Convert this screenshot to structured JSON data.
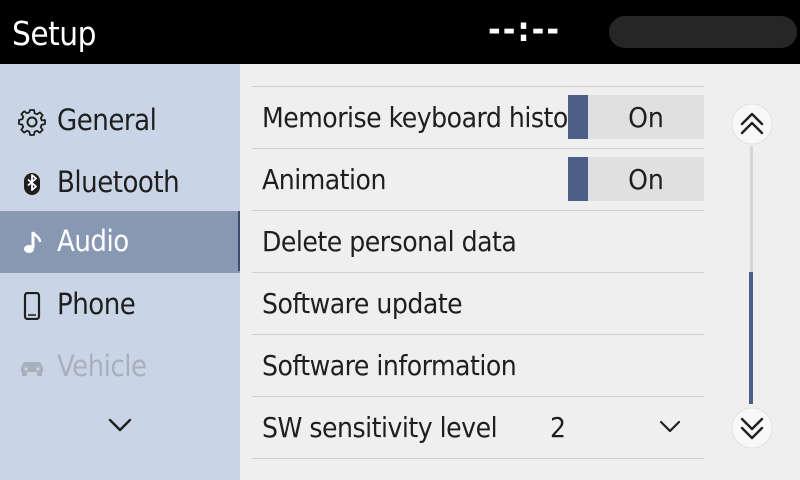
{
  "header": {
    "title": "Setup",
    "clock": "--:--"
  },
  "sidebar": {
    "items": [
      {
        "label": "General",
        "icon": "gear-icon",
        "state": "normal"
      },
      {
        "label": "Bluetooth",
        "icon": "bluetooth-icon",
        "state": "normal"
      },
      {
        "label": "Audio",
        "icon": "music-note-icon",
        "state": "selected"
      },
      {
        "label": "Phone",
        "icon": "phone-icon",
        "state": "normal"
      },
      {
        "label": "Vehicle",
        "icon": "car-icon",
        "state": "disabled"
      }
    ],
    "more_icon": "chevron-down-icon"
  },
  "settings": {
    "rows": [
      {
        "label": "Memorise keyboard history",
        "toggle": "On"
      },
      {
        "label": "Animation",
        "toggle": "On"
      },
      {
        "label": "Delete personal data"
      },
      {
        "label": "Software update"
      },
      {
        "label": "Software information"
      },
      {
        "label": "SW sensitivity level",
        "value": "2"
      }
    ]
  },
  "scroll": {
    "up_icon": "double-chevron-up-icon",
    "down_icon": "double-chevron-down-icon"
  },
  "colors": {
    "accent": "#4c5f86",
    "sidebar_bg": "#c9d5e6",
    "sidebar_selected": "#8898b3",
    "header_bg": "#000000"
  }
}
